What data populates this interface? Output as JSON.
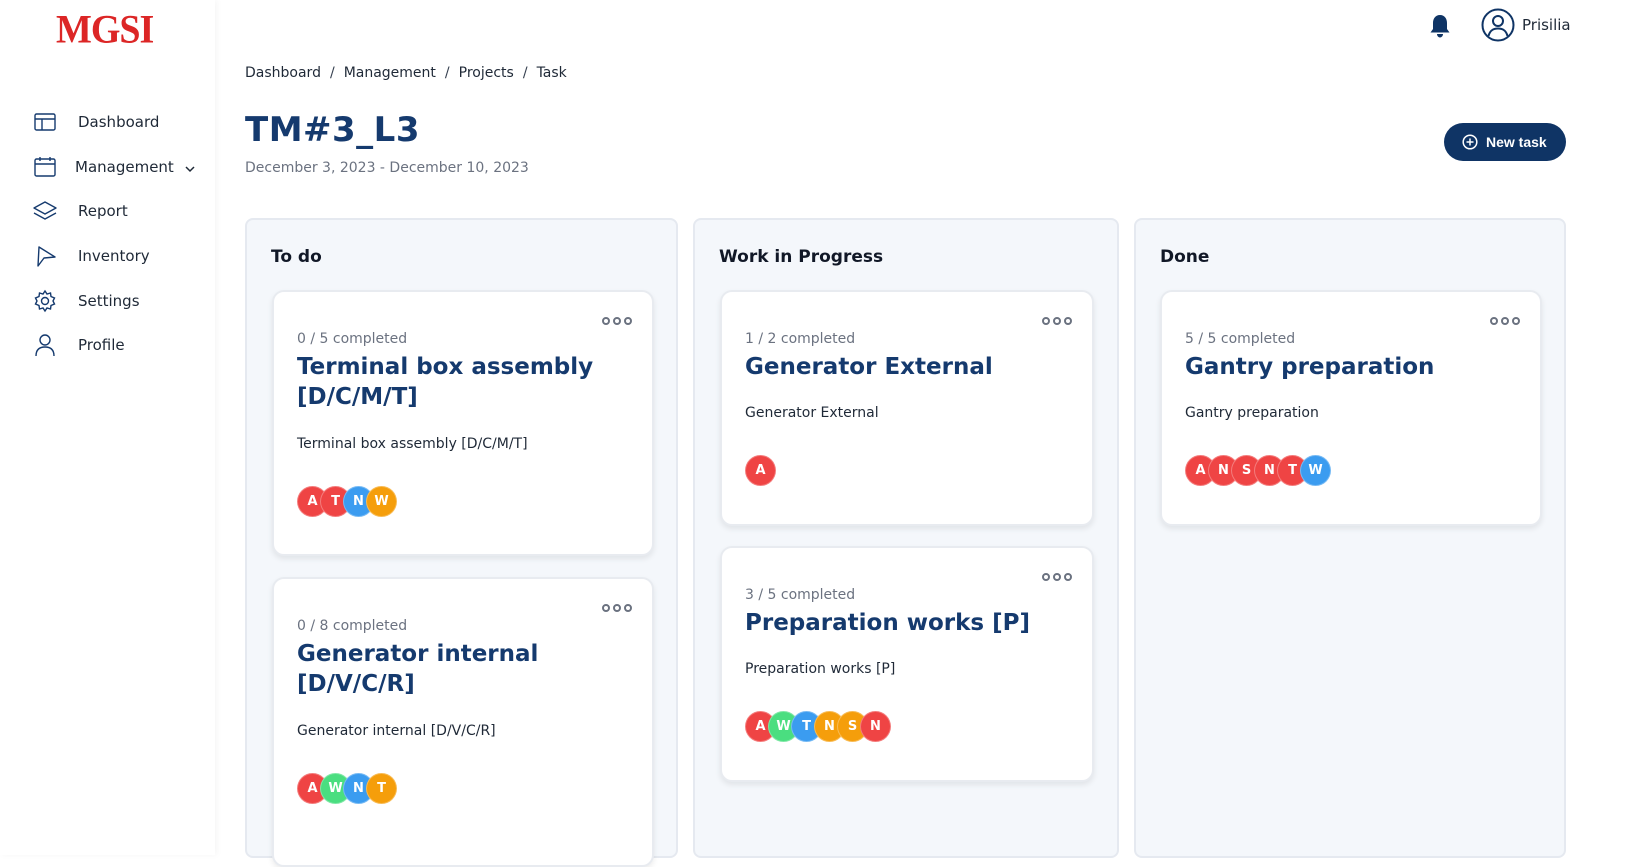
{
  "app": {
    "logo": "MGSI"
  },
  "sidebar": {
    "items": [
      {
        "label": "Dashboard",
        "icon": "table-icon"
      },
      {
        "label": "Management",
        "icon": "calendar-icon",
        "has_submenu": true
      },
      {
        "label": "Report",
        "icon": "layers-icon"
      },
      {
        "label": "Inventory",
        "icon": "send-icon"
      },
      {
        "label": "Settings",
        "icon": "gear-icon"
      },
      {
        "label": "Profile",
        "icon": "user-icon"
      }
    ]
  },
  "topbar": {
    "username": "Prisilia",
    "bell_icon": "bell-icon",
    "avatar_icon": "user-circle-icon"
  },
  "breadcrumb": [
    "Dashboard",
    "Management",
    "Projects",
    "Task"
  ],
  "page": {
    "title": "TM#3_L3",
    "date_range": "December 3, 2023 - December 10, 2023",
    "new_task_label": "New task"
  },
  "colors": {
    "brand_navy": "#153a6e",
    "button_navy": "#0f3465",
    "logo_red": "#dc2626",
    "avatar_red": "#ef4444",
    "avatar_blue": "#3b9cf0",
    "avatar_orange": "#f59e0b",
    "avatar_green": "#4ade80"
  },
  "board": {
    "columns": [
      {
        "title": "To do",
        "cards": [
          {
            "progress": "0 / 5 completed",
            "title_lines": [
              "Terminal box assembly",
              "[D/C/M/T]"
            ],
            "description": "Terminal box assembly [D/C/M/T]",
            "assignees": [
              "A",
              "T",
              "N",
              "W"
            ]
          },
          {
            "progress": "0 / 8 completed",
            "title_lines": [
              "Generator internal",
              "[D/V/C/R]"
            ],
            "description": "Generator internal [D/V/C/R]",
            "assignees": [
              "A",
              "W",
              "N",
              "T"
            ]
          }
        ]
      },
      {
        "title": "Work in Progress",
        "cards": [
          {
            "progress": "1 / 2 completed",
            "title_lines": [
              "Generator External"
            ],
            "description": "Generator External",
            "assignees": [
              "A"
            ]
          },
          {
            "progress": "3 / 5 completed",
            "title_lines": [
              "Preparation works [P]"
            ],
            "description": "Preparation works [P]",
            "assignees": [
              "A",
              "W",
              "T",
              "N",
              "S",
              "N"
            ]
          }
        ]
      },
      {
        "title": "Done",
        "cards": [
          {
            "progress": "5 / 5 completed",
            "title_lines": [
              "Gantry preparation"
            ],
            "description": "Gantry preparation",
            "assignees": [
              "A",
              "N",
              "S",
              "N",
              "T",
              "W"
            ]
          }
        ]
      }
    ]
  }
}
